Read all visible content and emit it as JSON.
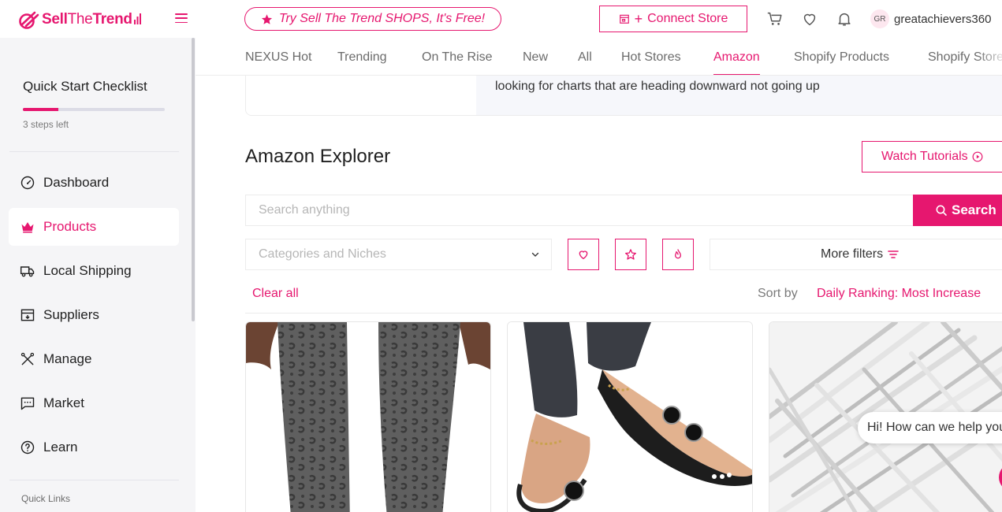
{
  "header": {
    "logo_bold_1": "Sell",
    "logo_thin": "The",
    "logo_bold_2": "Trend",
    "promo_text": "Try Sell The Trend SHOPS, It's Free!",
    "connect_label": "Connect Store",
    "user_initials": "GR",
    "username": "greatachievers360",
    "icons": [
      "menu-icon",
      "star-icon",
      "store-icon",
      "cart-icon",
      "heart-icon",
      "bell-icon"
    ]
  },
  "tabs": [
    {
      "label": "NEXUS Hot"
    },
    {
      "label": "Trending"
    },
    {
      "label": "On The Rise"
    },
    {
      "label": "New"
    },
    {
      "label": "All"
    },
    {
      "label": "Hot Stores"
    },
    {
      "label": "Amazon",
      "active": true
    },
    {
      "label": "Shopify Products"
    },
    {
      "label": "Shopify Stores"
    }
  ],
  "sidebar": {
    "checklist_title": "Quick Start Checklist",
    "checklist_progress": 0.25,
    "checklist_sub": "3 steps left",
    "items": [
      {
        "label": "Dashboard",
        "icon": "gauge-icon"
      },
      {
        "label": "Products",
        "icon": "crown-icon",
        "active": true
      },
      {
        "label": "Local Shipping",
        "icon": "truck-icon"
      },
      {
        "label": "Suppliers",
        "icon": "box-icon"
      },
      {
        "label": "Manage",
        "icon": "tools-icon"
      },
      {
        "label": "Market",
        "icon": "chat-icon"
      },
      {
        "label": "Learn",
        "icon": "help-icon"
      }
    ],
    "quick_links": "Quick Links"
  },
  "main": {
    "info_text": "looking for charts that are heading downward not going up",
    "title": "Amazon Explorer",
    "watch_label": "Watch Tutorials",
    "search_placeholder": "Search anything",
    "search_button": "Search",
    "category_placeholder": "Categories and Niches",
    "more_filters": "More filters",
    "clear_all": "Clear all",
    "sort_label": "Sort by",
    "sort_value": "Daily Ranking: Most Increase"
  },
  "products": [
    {
      "name": "leopard-leggings"
    },
    {
      "name": "black-sandals"
    },
    {
      "name": "white-twist-ties"
    }
  ],
  "chat": {
    "greeting": "Hi! How can we help you?"
  },
  "colors": {
    "accent": "#e6176f",
    "sidebar_bg": "#f5f5f7",
    "border": "#ececec"
  }
}
